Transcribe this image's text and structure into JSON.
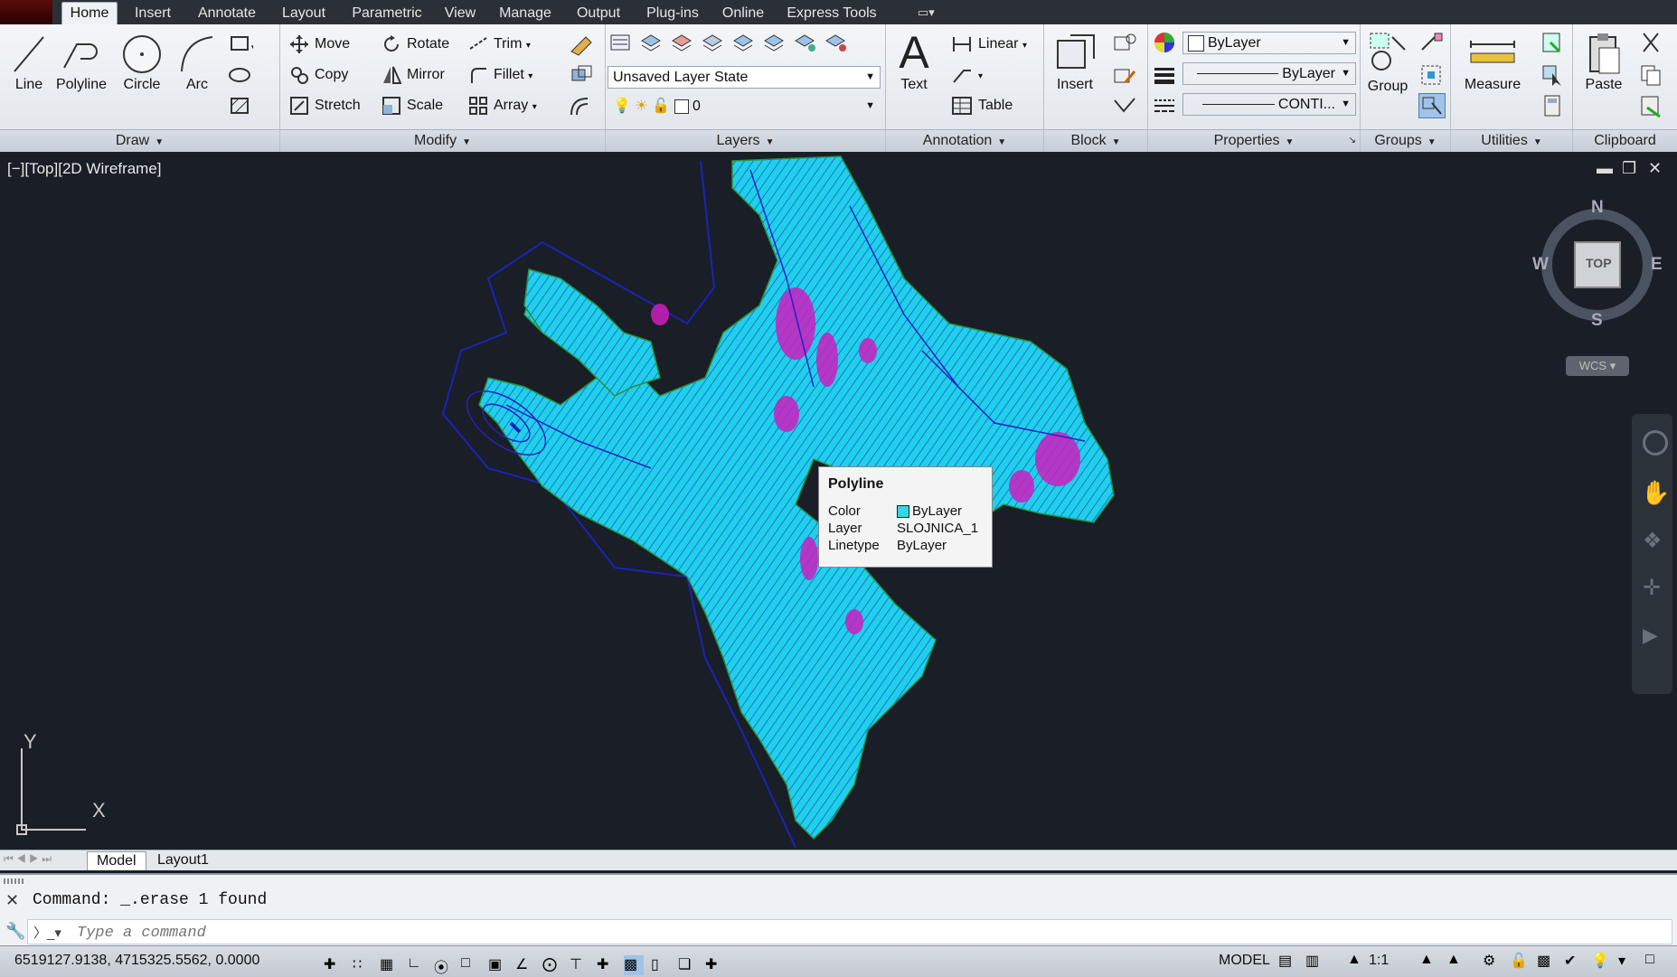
{
  "menu": {
    "tabs": [
      "Home",
      "Insert",
      "Annotate",
      "Layout",
      "Parametric",
      "View",
      "Manage",
      "Output",
      "Plug-ins",
      "Online",
      "Express Tools"
    ],
    "active_tab": "Home"
  },
  "ribbon": {
    "draw": {
      "title": "Draw",
      "line": "Line",
      "polyline": "Polyline",
      "circle": "Circle",
      "arc": "Arc"
    },
    "modify": {
      "title": "Modify",
      "move": "Move",
      "rotate": "Rotate",
      "trim": "Trim",
      "copy": "Copy",
      "mirror": "Mirror",
      "fillet": "Fillet",
      "stretch": "Stretch",
      "scale": "Scale",
      "array": "Array"
    },
    "layers": {
      "title": "Layers",
      "layer_state": "Unsaved Layer State",
      "current_layer": "0"
    },
    "annotation": {
      "title": "Annotation",
      "text": "Text",
      "linear": "Linear",
      "table": "Table"
    },
    "block": {
      "title": "Block",
      "insert": "Insert"
    },
    "properties": {
      "title": "Properties",
      "color": "ByLayer",
      "lineweight": "ByLayer",
      "linetype": "CONTI..."
    },
    "groups": {
      "title": "Groups",
      "group": "Group"
    },
    "utilities": {
      "title": "Utilities",
      "measure": "Measure"
    },
    "clipboard": {
      "title": "Clipboard",
      "paste": "Paste"
    }
  },
  "viewport": {
    "label": "[−][Top][2D Wireframe]",
    "viewcube": {
      "n": "N",
      "s": "S",
      "e": "E",
      "w": "W",
      "top": "TOP",
      "wcs": "WCS"
    },
    "ucs": {
      "x": "X",
      "y": "Y"
    }
  },
  "tooltip": {
    "title": "Polyline",
    "rows": [
      {
        "key": "Color",
        "value": "ByLayer",
        "swatch": "#33d6e6"
      },
      {
        "key": "Layer",
        "value": "SLOJNICA_1"
      },
      {
        "key": "Linetype",
        "value": "ByLayer"
      }
    ]
  },
  "layout_tabs": [
    "Model",
    "Layout1"
  ],
  "command": {
    "history": "Command: _.erase 1 found",
    "placeholder": "Type a command"
  },
  "status": {
    "coords": "6519127.9138, 4715325.5562, 0.0000",
    "model": "MODEL",
    "scale": "1:1"
  },
  "colors": {
    "map_fill": "#1fd0e8",
    "map_accent": "#cc1fbf",
    "contour": "#1a24b8",
    "background": "#1a1e26"
  }
}
